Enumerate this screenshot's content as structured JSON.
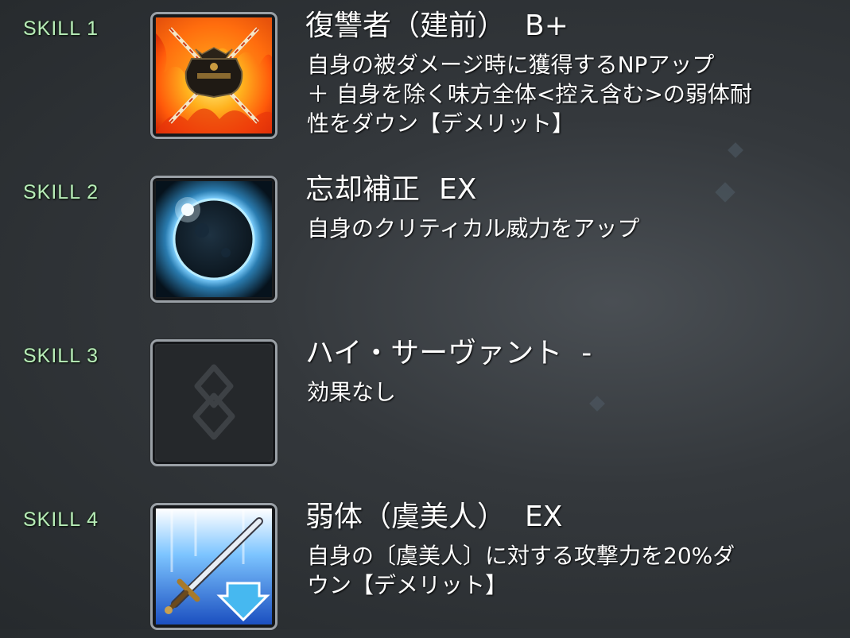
{
  "skills": [
    {
      "label": "SKILL 1",
      "name": "復讐者（建前）",
      "rank": "B+",
      "desc_lines": [
        "自身の被ダメージ時に獲得するNPアップ",
        "＋ 自身を除く味方全体<控え含む>の弱体耐",
        "性をダウン【デメリット】"
      ],
      "icon": "flame-crest-icon"
    },
    {
      "label": "SKILL 2",
      "name": "忘却補正",
      "rank": "EX",
      "desc_lines": [
        "自身のクリティカル威力をアップ"
      ],
      "icon": "eclipse-icon"
    },
    {
      "label": "SKILL 3",
      "name": "ハイ・サーヴァント",
      "rank": "-",
      "desc_lines": [
        "効果なし"
      ],
      "icon": "empty-seal-icon"
    },
    {
      "label": "SKILL 4",
      "name": "弱体（虞美人）",
      "rank": "EX",
      "desc_lines": [
        "自身の〔虞美人〕に対する攻撃力を20%ダ",
        "ウン【デメリット】"
      ],
      "icon": "sword-down-icon"
    }
  ],
  "colors": {
    "skill_label": "#b8ecb8",
    "text": "#ffffff",
    "frame": "#9aa0a6"
  }
}
